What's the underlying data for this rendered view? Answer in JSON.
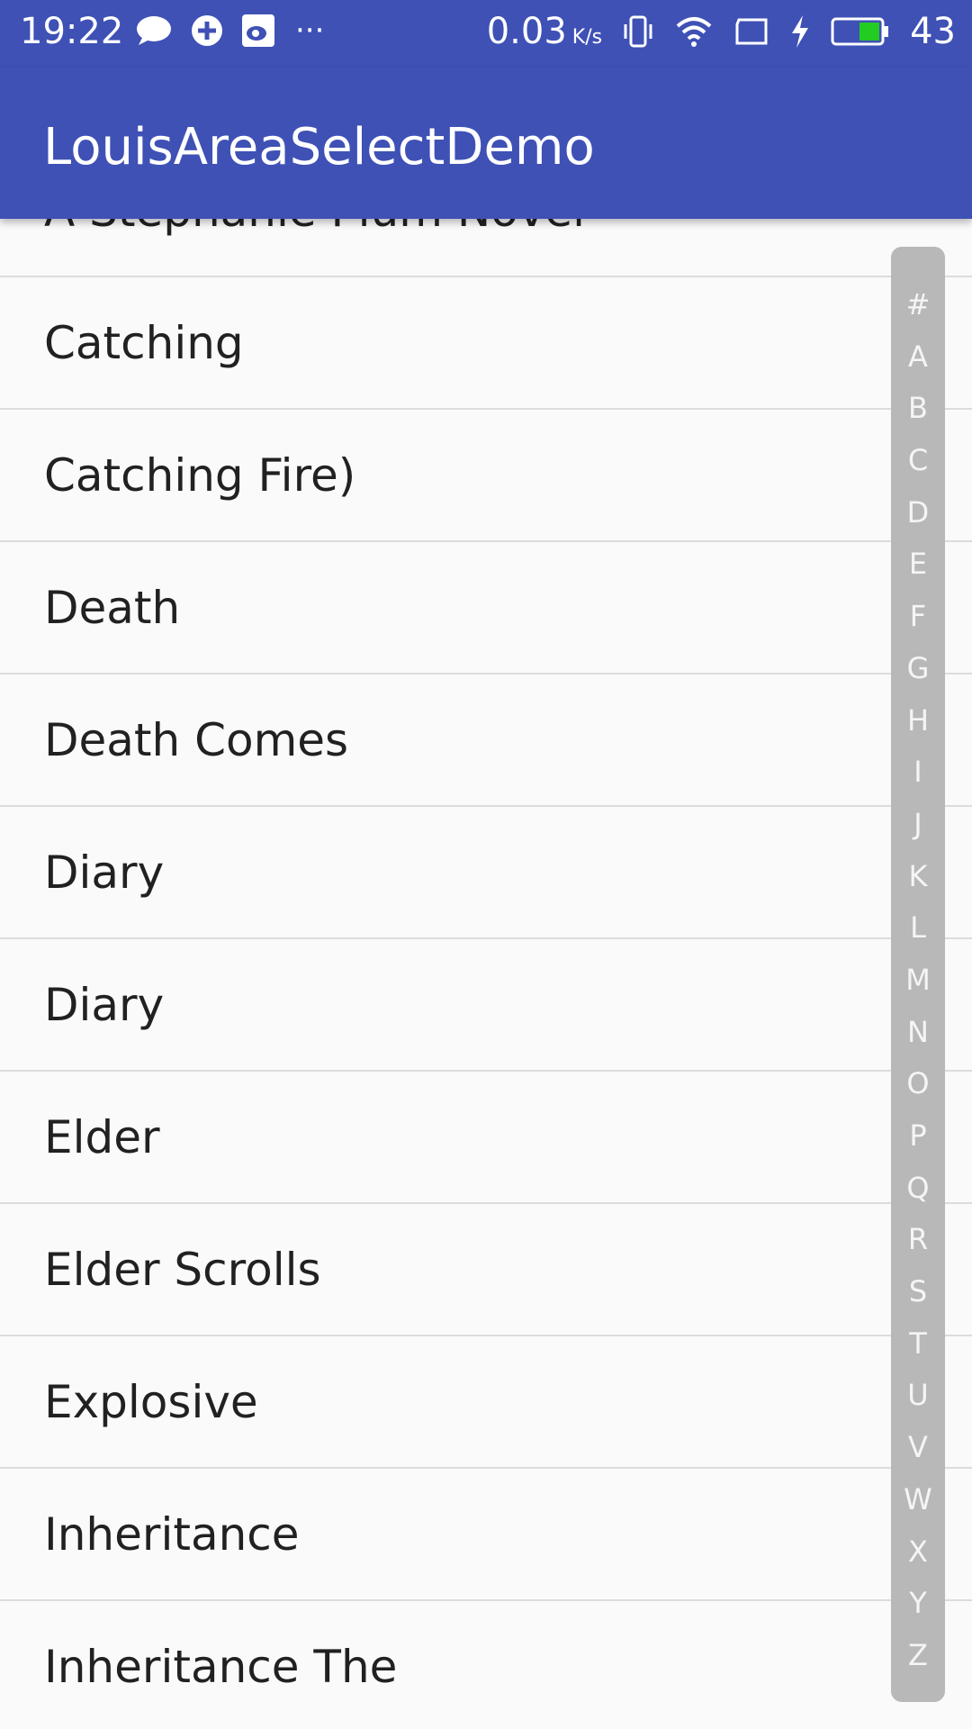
{
  "status_bar": {
    "time": "19:22",
    "more": "···",
    "network_speed": "0.03",
    "network_unit": "K/s",
    "battery_level": "43",
    "battery_color": "#22cc22"
  },
  "app_bar": {
    "title": "LouisAreaSelectDemo",
    "color": "#3f51b5"
  },
  "list": {
    "items": [
      "A Stephanie Plum Novel",
      "Catching",
      "Catching Fire)",
      "Death",
      "Death Comes",
      "Diary",
      "Diary",
      "Elder",
      "Elder Scrolls",
      "Explosive",
      "Inheritance",
      "Inheritance The"
    ]
  },
  "index_bar": {
    "letters": [
      "#",
      "A",
      "B",
      "C",
      "D",
      "E",
      "F",
      "G",
      "H",
      "I",
      "J",
      "K",
      "L",
      "M",
      "N",
      "O",
      "P",
      "Q",
      "R",
      "S",
      "T",
      "U",
      "V",
      "W",
      "X",
      "Y",
      "Z"
    ]
  }
}
